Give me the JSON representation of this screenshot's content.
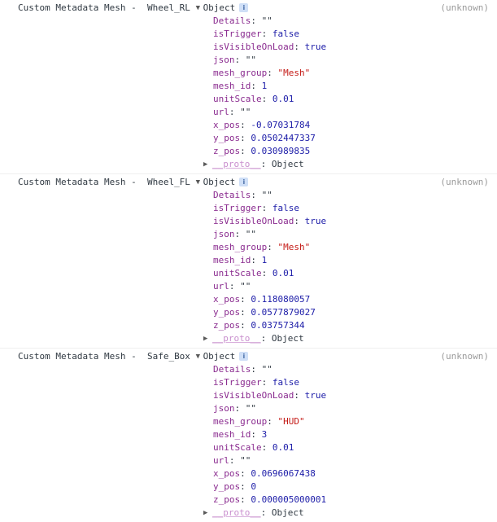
{
  "console": {
    "icons": {
      "expanded_triangle": "▼",
      "collapsed_triangle": "▶",
      "info_badge": "i"
    },
    "object_label": "Object",
    "proto_key": "__proto__",
    "proto_value": "Object",
    "colon": ": ",
    "colors": {
      "property_name": "#8a2b8f",
      "string_value": "#c41a16",
      "boolean_value": "#1c1ca8",
      "number_value": "#1c1ca8",
      "source_link": "#9a9a9a",
      "badge_background": "#cfdff7",
      "badge_text": "#4a6fa8",
      "default_text": "#303942",
      "divider": "#f0f0f0",
      "background": "#ffffff"
    },
    "groups": [
      {
        "message_prefix": "Custom Metadata Mesh - ",
        "message_name": " Wheel_RL ",
        "source": "(unknown)",
        "properties": [
          {
            "key": "Details",
            "value": "\"\"",
            "type": "string-empty"
          },
          {
            "key": "isTrigger",
            "value": "false",
            "type": "boolean"
          },
          {
            "key": "isVisibleOnLoad",
            "value": "true",
            "type": "boolean"
          },
          {
            "key": "json",
            "value": "\"\"",
            "type": "string-empty"
          },
          {
            "key": "mesh_group",
            "value": "\"Mesh\"",
            "type": "string"
          },
          {
            "key": "mesh_id",
            "value": "1",
            "type": "number"
          },
          {
            "key": "unitScale",
            "value": "0.01",
            "type": "number"
          },
          {
            "key": "url",
            "value": "\"\"",
            "type": "string-empty"
          },
          {
            "key": "x_pos",
            "value": "-0.07031784",
            "type": "number"
          },
          {
            "key": "y_pos",
            "value": "0.0502447337",
            "type": "number"
          },
          {
            "key": "z_pos",
            "value": "0.030989835",
            "type": "number"
          }
        ]
      },
      {
        "message_prefix": "Custom Metadata Mesh - ",
        "message_name": " Wheel_FL ",
        "source": "(unknown)",
        "properties": [
          {
            "key": "Details",
            "value": "\"\"",
            "type": "string-empty"
          },
          {
            "key": "isTrigger",
            "value": "false",
            "type": "boolean"
          },
          {
            "key": "isVisibleOnLoad",
            "value": "true",
            "type": "boolean"
          },
          {
            "key": "json",
            "value": "\"\"",
            "type": "string-empty"
          },
          {
            "key": "mesh_group",
            "value": "\"Mesh\"",
            "type": "string"
          },
          {
            "key": "mesh_id",
            "value": "1",
            "type": "number"
          },
          {
            "key": "unitScale",
            "value": "0.01",
            "type": "number"
          },
          {
            "key": "url",
            "value": "\"\"",
            "type": "string-empty"
          },
          {
            "key": "x_pos",
            "value": "0.118080057",
            "type": "number"
          },
          {
            "key": "y_pos",
            "value": "0.0577879027",
            "type": "number"
          },
          {
            "key": "z_pos",
            "value": "0.03757344",
            "type": "number"
          }
        ]
      },
      {
        "message_prefix": "Custom Metadata Mesh - ",
        "message_name": " Safe_Box ",
        "source": "(unknown)",
        "properties": [
          {
            "key": "Details",
            "value": "\"\"",
            "type": "string-empty"
          },
          {
            "key": "isTrigger",
            "value": "false",
            "type": "boolean"
          },
          {
            "key": "isVisibleOnLoad",
            "value": "true",
            "type": "boolean"
          },
          {
            "key": "json",
            "value": "\"\"",
            "type": "string-empty"
          },
          {
            "key": "mesh_group",
            "value": "\"HUD\"",
            "type": "string"
          },
          {
            "key": "mesh_id",
            "value": "3",
            "type": "number"
          },
          {
            "key": "unitScale",
            "value": "0.01",
            "type": "number"
          },
          {
            "key": "url",
            "value": "\"\"",
            "type": "string-empty"
          },
          {
            "key": "x_pos",
            "value": "0.0696067438",
            "type": "number"
          },
          {
            "key": "y_pos",
            "value": "0",
            "type": "number"
          },
          {
            "key": "z_pos",
            "value": "0.000005000001",
            "type": "number"
          }
        ]
      }
    ]
  }
}
